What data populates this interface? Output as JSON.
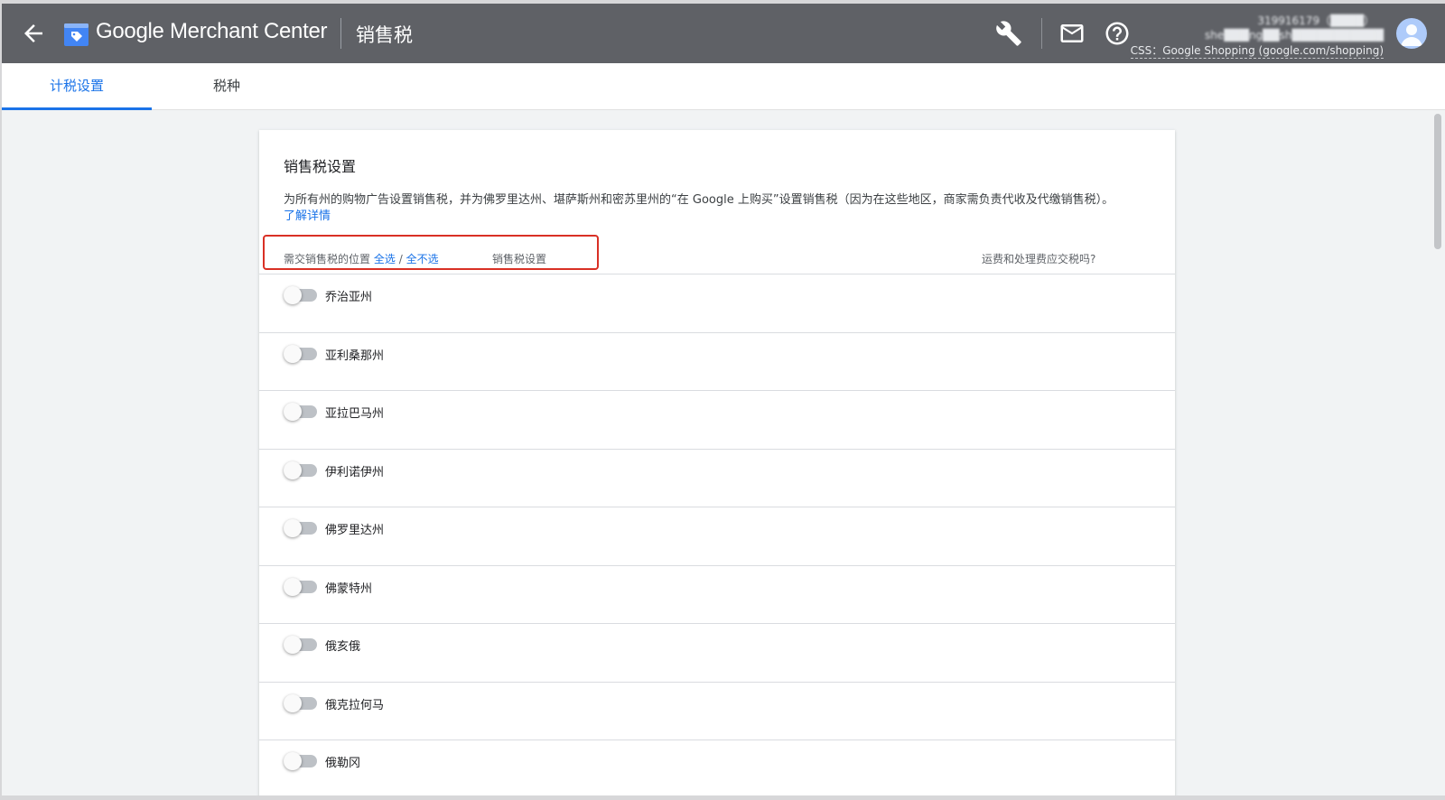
{
  "header": {
    "logo_text": "Google Merchant Center",
    "page_title": "销售税",
    "account_id": "319916179（████）",
    "account_email": "she███ng██sh███████████",
    "css_label": "CSS：Google Shopping (google.com/shopping)"
  },
  "tabs": [
    {
      "label": "计税设置",
      "active": true
    },
    {
      "label": "税种",
      "active": false
    }
  ],
  "card": {
    "title": "销售税设置",
    "description": "为所有州的购物广告设置销售税，并为佛罗里达州、堪萨斯州和密苏里州的“在 Google 上购买”设置销售税（因为在这些地区，商家需负责代收及代缴销售税）。",
    "learn_more": "了解详情",
    "columns": {
      "location": "需交销售税的位置",
      "select_all": "全选",
      "separator": "/",
      "deselect_all": "全不选",
      "setting": "销售税设置",
      "shipping": "运费和处理费应交税吗?"
    },
    "states": [
      {
        "name": "乔治亚州",
        "enabled": false
      },
      {
        "name": "亚利桑那州",
        "enabled": false
      },
      {
        "name": "亚拉巴马州",
        "enabled": false
      },
      {
        "name": "伊利诺伊州",
        "enabled": false
      },
      {
        "name": "佛罗里达州",
        "enabled": false
      },
      {
        "name": "佛蒙特州",
        "enabled": false
      },
      {
        "name": "俄亥俄",
        "enabled": false
      },
      {
        "name": "俄克拉何马",
        "enabled": false
      },
      {
        "name": "俄勒冈",
        "enabled": false
      }
    ]
  },
  "colors": {
    "header_bg": "#5f6166",
    "accent": "#1a73e8",
    "highlight": "#d93025"
  }
}
